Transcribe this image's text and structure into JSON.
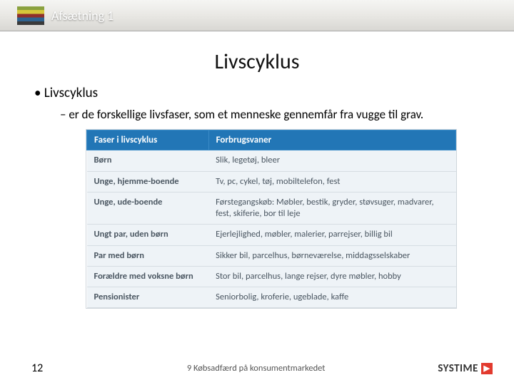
{
  "header": {
    "course": "Afsætning",
    "course_num": "1"
  },
  "title": "Livscyklus",
  "bullet1": "Livscyklus",
  "bullet2": "er de forskellige livsfaser, som et menneske gennemfår fra vugge til grav.",
  "table": {
    "head": [
      "Faser i livscyklus",
      "Forbrugsvaner"
    ],
    "rows": [
      [
        "Børn",
        "Slik, legetøj, bleer"
      ],
      [
        "Unge, hjemme-boende",
        "Tv, pc, cykel, tøj, mobiltelefon, fest"
      ],
      [
        "Unge, ude-boende",
        "Førstegangskøb: Møbler, bestik, gryder, støvsuger, madvarer, fest, skiferie, bor til leje"
      ],
      [
        "Ungt par, uden børn",
        "Ejerlejlighed, møbler, malerier, parrejser, billig bil"
      ],
      [
        "Par med børn",
        "Sikker bil, parcelhus, børneværelse, middagsselskaber"
      ],
      [
        "Forældre med voksne børn",
        "Stor bil, parcelhus, lange rejser, dyre møbler, hobby"
      ],
      [
        "Pensionister",
        "Seniorbolig, kroferie, ugeblade, kaffe"
      ]
    ]
  },
  "footer": {
    "page": "12",
    "chapter": "9  Købsadfærd på konsumentmarkedet",
    "brand": "SYSTIME"
  }
}
